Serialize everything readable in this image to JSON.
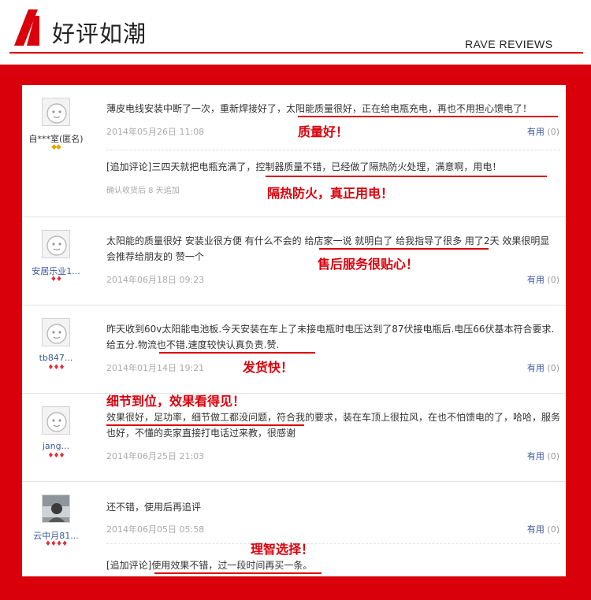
{
  "header": {
    "title": "好评如潮",
    "subtitle": "RAVE REVIEWS"
  },
  "colors": {
    "accent": "#d9000b",
    "link": "#3a5a9c",
    "muted": "#aaaaaa"
  },
  "useful_label": "有用",
  "reviews": [
    {
      "user": "自***室(匿名)",
      "avatar": "default-avatar-icon",
      "rank": "◆◆",
      "text": "薄皮电线安装中断了一次，重新焊接好了，太阳能质量很好，正在给电瓶充电，再也不用担心馈电了！",
      "date": "2014年05月26日 11:08",
      "useful_count": "(0)",
      "highlight_tag": "质量好！",
      "followup": "[追加评论]三四天就把电瓶充满了，控制器质量不错，已经做了隔热防火处理，满意啊，用电！",
      "followup_meta": "确认收货后 8 天追加",
      "followup_tag": "隔热防火，真正用电！"
    },
    {
      "user": "安居乐业1...",
      "avatar": "default-avatar-icon",
      "rank": "♦♦",
      "text": "太阳能的质量很好 安装业很方便 有什么不会的 给店家一说 就明白了 给我指导了很多 用了2天 效果很明显 会推荐给朋友的 赞一个",
      "date": "2014年06月18日 09:23",
      "useful_count": "(0)",
      "highlight_tag": "售后服务很贴心！"
    },
    {
      "user": "tb847...",
      "avatar": "default-avatar-icon",
      "rank": "♦♦♦",
      "text": "昨天收到60v太阳能电池板.今天安装在车上了未接电瓶时电压达到了87伏接电瓶后.电压66伏基本符合要求.给五分.物流也不错.速度较快认真负责.赞.",
      "date": "2014年01月14日 19:21",
      "useful_count": "(0)",
      "highlight_tag": "发货快！"
    },
    {
      "user": "jang...",
      "avatar": "default-avatar-icon",
      "rank": "♦♦♦",
      "highlight_tag": "细节到位，效果看得见！",
      "text": "效果很好，足功率，细节做工都没问题，符合我的要求，装在车顶上很拉风，在也不怕馈电的了，哈哈，服务也好，不懂的卖家直接打电话过来教，很感谢",
      "date": "2014年06月25日 21:03",
      "useful_count": "(0)"
    },
    {
      "user": "云中月81...",
      "avatar": "photo-avatar-icon",
      "rank": "♦♦♦♦",
      "text": "还不错，使用后再追评",
      "date": "2014年06月05日 05:58",
      "useful_count": "(0)",
      "followup_tag": "理智选择！",
      "followup": "[追加评论]使用效果不错，过一段时间再买一条。"
    }
  ]
}
